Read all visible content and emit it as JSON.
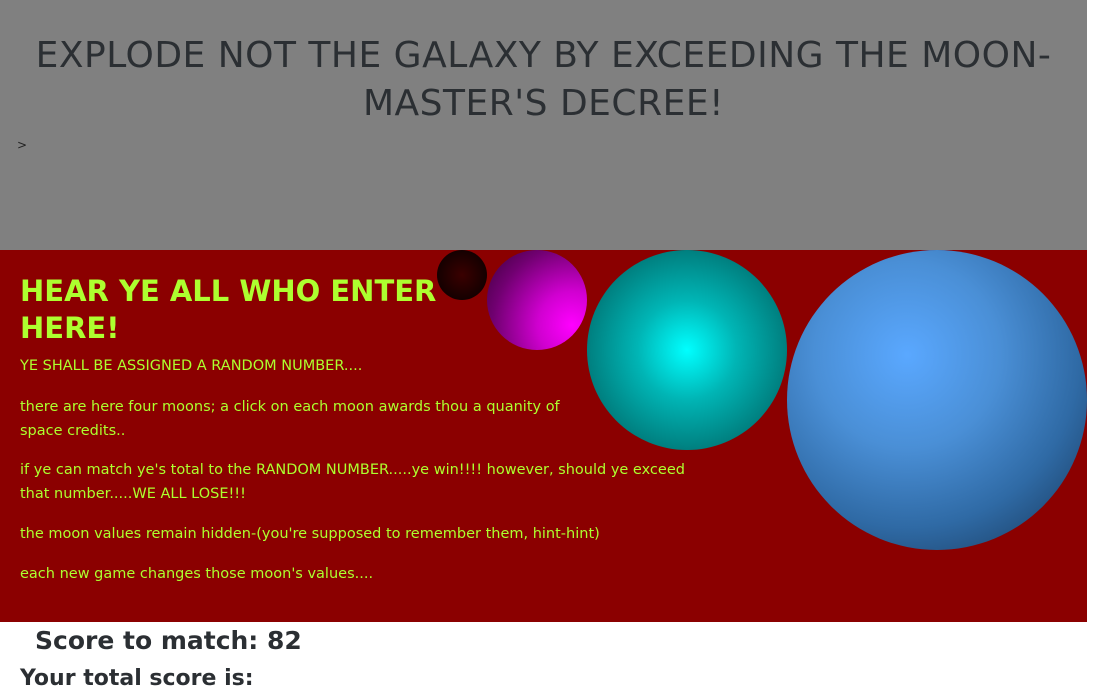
{
  "header": {
    "title": "EXPLODE NOT THE GALAXY BY EXCEEDING THE MOON-MASTER'S DECREE!",
    "prompt": ">"
  },
  "instructions": {
    "heading": "HEAR YE ALL WHO ENTER HERE!",
    "paragraphs": [
      "YE SHALL BE ASSIGNED A RANDOM NUMBER....",
      "there are here four moons; a click on each moon awards thou a quanity of space credits..",
      "if ye can match ye's total to the RANDOM NUMBER.....ye win!!!! however, should ye exceed that number.....WE ALL LOSE!!!",
      "the moon values remain hidden-(you're supposed to remember them, hint-hint)",
      "each new game changes those moon's values...."
    ]
  },
  "moons": [
    {
      "name": "dark-red-moon",
      "color": "#3a0000"
    },
    {
      "name": "magenta-moon",
      "color": "#ff00ff"
    },
    {
      "name": "cyan-moon",
      "color": "#00ffff"
    },
    {
      "name": "blue-moon",
      "color": "#5aa8ff"
    }
  ],
  "score": {
    "target_label": "Score to match: 82",
    "total_label": "Your total score is:"
  },
  "colors": {
    "header_bg": "#808080",
    "panel_bg": "#8b0000",
    "accent_text": "#adff2f"
  }
}
